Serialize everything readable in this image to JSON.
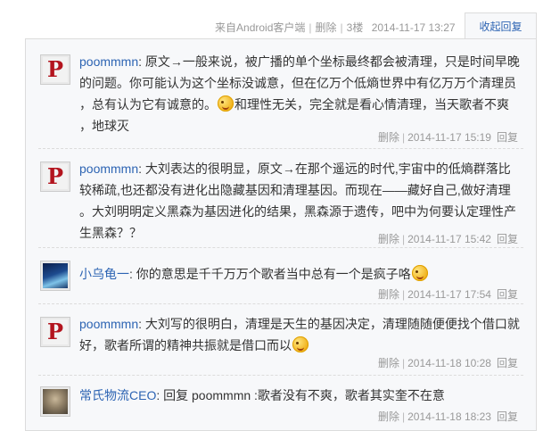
{
  "header": {
    "source_prefix": "来自",
    "source": "Android客户端",
    "delete": "删除",
    "floor": "3楼",
    "datetime": "2014-11-17 13:27",
    "fold_reply": "收起回复"
  },
  "replies": [
    {
      "user": "poommmn",
      "lines": [
        "原文→一般来说，被广播的单个坐标最终都会被清理，只是时间早晚",
        "的问题。你可能认为这个坐标没诚意，但在亿万个低熵世界中有亿万万个清理员",
        "，总有认为它有诚意的。",
        "和理性无关，完全就是看心情清理，当天歌者不爽",
        "，地球灭"
      ],
      "delete": "删除",
      "datetime": "2014-11-17 15:19",
      "reply": "回复"
    },
    {
      "user": "poommmn",
      "lines": [
        "大刘表达的很明显，原文→在那个遥远的时代,宇宙中的低熵群落比",
        "较稀疏,也还都没有进化出隐藏基因和清理基因。而现在——藏好自己,做好清理",
        "。大刘明明定义黑森为基因进化的结果，黑森源于遗传，吧中为何要认定理性产",
        "生黑森？？"
      ],
      "delete": "删除",
      "datetime": "2014-11-17 15:42",
      "reply": "回复"
    },
    {
      "user": "小乌龟一",
      "lines": [
        "你的意思是千千万万个歌者当中总有一个是疯子咯"
      ],
      "delete": "删除",
      "datetime": "2014-11-17 17:54",
      "reply": "回复"
    },
    {
      "user": "poommmn",
      "lines": [
        "大刘写的很明白，清理是天生的基因决定，清理随随便便找个借口就",
        "好，歌者所谓的精神共振就是借口而以"
      ],
      "delete": "删除",
      "datetime": "2014-11-18 10:28",
      "reply": "回复"
    },
    {
      "user": "常氏物流CEO",
      "lines": [
        "回复 poommmn :歌者没有不爽，歌者其实奎不在意"
      ],
      "delete": "删除",
      "datetime": "2014-11-18 18:23",
      "reply": "回复"
    }
  ],
  "icons": {
    "avatar_p": "P",
    "emoji": "smiley-emoji-icon"
  },
  "colors": {
    "link": "#2d64b3",
    "muted": "#999999",
    "panel_bg": "#f7f8fa",
    "avatar_letter": "#b3141e"
  }
}
